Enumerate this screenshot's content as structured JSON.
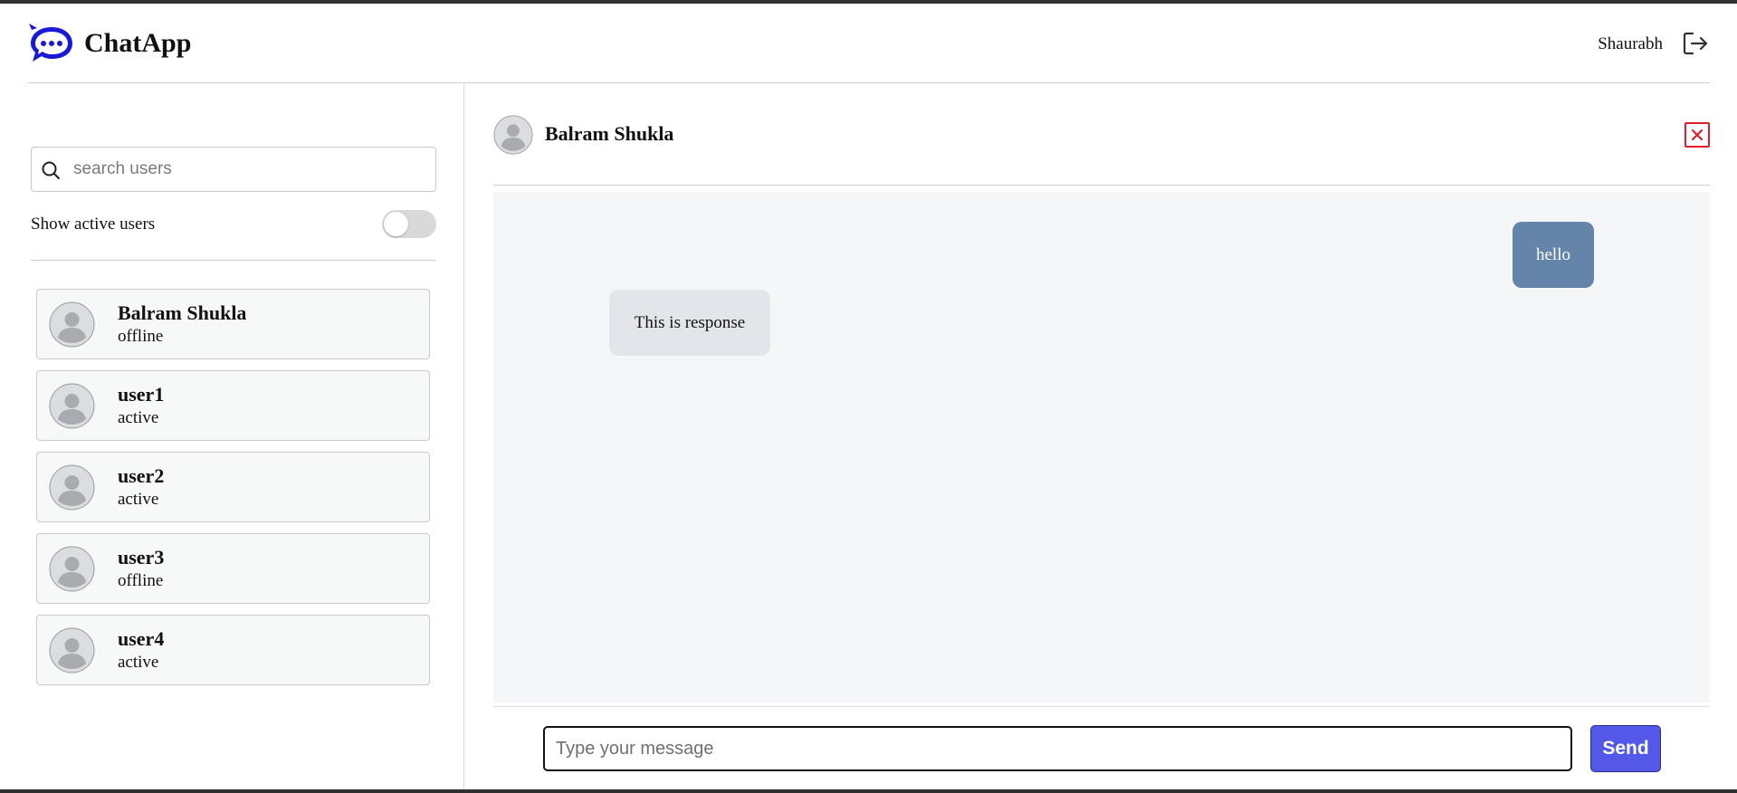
{
  "app": {
    "title": "ChatApp",
    "logo_icon": "chat-bubble-icon",
    "brand_color": "#1a1ad6"
  },
  "header": {
    "user_name": "Shaurabh",
    "logout_icon": "logout-icon"
  },
  "sidebar": {
    "search": {
      "placeholder": "search users",
      "value": "",
      "icon": "search-icon"
    },
    "active_filter": {
      "label": "Show active users",
      "enabled": false
    },
    "users": [
      {
        "name": "Balram Shukla",
        "status": "offline"
      },
      {
        "name": "user1",
        "status": "active"
      },
      {
        "name": "user2",
        "status": "active"
      },
      {
        "name": "user3",
        "status": "offline"
      },
      {
        "name": "user4",
        "status": "active"
      }
    ]
  },
  "chat": {
    "contact_name": "Balram Shukla",
    "close_icon": "close-icon",
    "close_color": "#e11d2a",
    "messages": [
      {
        "direction": "outgoing",
        "text": "hello",
        "color": "#6485a9"
      },
      {
        "direction": "incoming",
        "text": "This is response",
        "color": "#e4e5ea"
      }
    ],
    "composer": {
      "placeholder": "Type your message",
      "value": "",
      "send_label": "Send",
      "send_color": "#5358e8"
    }
  }
}
